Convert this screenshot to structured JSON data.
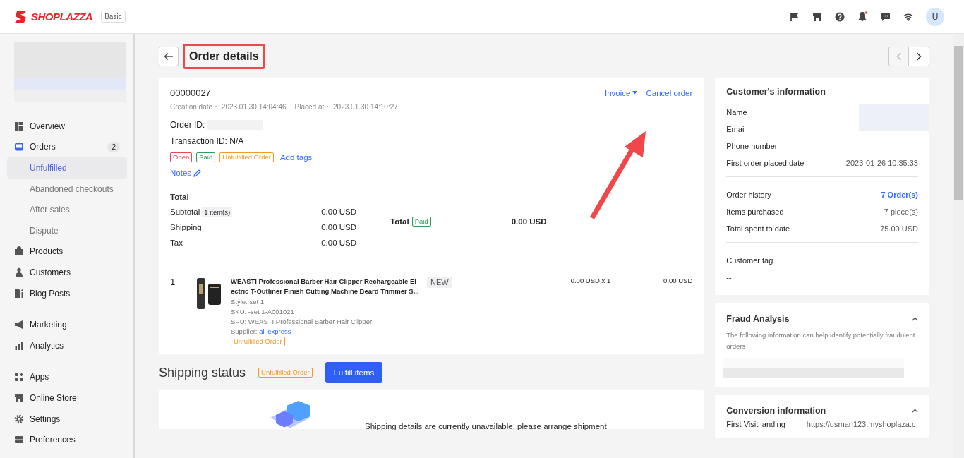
{
  "topbar": {
    "logo": "SHOPLAZZA",
    "plan": "Basic",
    "notification_dot": true,
    "avatar": "U"
  },
  "sidebar": {
    "groups": [
      [
        {
          "label": "Overview",
          "kind": "main",
          "selected": false
        },
        {
          "label": "Orders",
          "kind": "main",
          "selected": false,
          "badge": "2"
        },
        {
          "label": "Unfulfilled",
          "kind": "sub",
          "selected": true
        },
        {
          "label": "Abandoned checkouts",
          "kind": "sub",
          "selected": false
        },
        {
          "label": "After sales",
          "kind": "sub",
          "selected": false
        },
        {
          "label": "Dispute",
          "kind": "sub",
          "selected": false
        },
        {
          "label": "Products",
          "kind": "main",
          "selected": false
        },
        {
          "label": "Customers",
          "kind": "main",
          "selected": false
        },
        {
          "label": "Blog Posts",
          "kind": "main",
          "selected": false
        }
      ],
      [
        {
          "label": "Marketing",
          "kind": "main",
          "selected": false
        },
        {
          "label": "Analytics",
          "kind": "main",
          "selected": false
        }
      ],
      [
        {
          "label": "Apps",
          "kind": "main",
          "selected": false
        },
        {
          "label": "Online Store",
          "kind": "main",
          "selected": false
        },
        {
          "label": "Settings",
          "kind": "main",
          "selected": false
        },
        {
          "label": "Preferences",
          "kind": "main",
          "selected": false
        }
      ]
    ]
  },
  "page": {
    "title": "Order details",
    "prev_disabled": true,
    "next_disabled": false
  },
  "order": {
    "number": "00000027",
    "invoice": "Invoice",
    "cancel": "Cancel order",
    "meta": [
      {
        "label": "Creation date：",
        "value": "2023.01.30 14:04:46"
      },
      {
        "label": "Placed at：",
        "value": "2023.01.30 14:10:27"
      }
    ],
    "order_id": "Order ID:",
    "transaction": "Transaction ID: N/A",
    "tags": [
      {
        "label": "Open",
        "color": "#e5484d"
      },
      {
        "label": "Paid",
        "color": "#2e9e5b"
      },
      {
        "label": "Unfulfilled Order",
        "color": "#f59a23"
      }
    ],
    "add_tags": "Add tags",
    "notes": "Notes",
    "totals": {
      "heading": "Total",
      "rows": [
        {
          "label": "Subtotal",
          "badge": "1 item(s)",
          "value": "0.00 USD"
        },
        {
          "label": "Shipping",
          "value": "0.00 USD"
        },
        {
          "label": "Tax",
          "value": "0.00 USD"
        }
      ],
      "grand_label": "Total",
      "grand_tag": {
        "label": "Paid",
        "color": "#2e9e5b"
      },
      "grand_value": "0.00 USD"
    },
    "items": [
      {
        "index": "1",
        "title": "WEASTI Professional Barber Hair Clipper Rechargeable Electric T-Outliner Finish Cutting Machine Beard Trimmer S...",
        "badge": "NEW",
        "style": "Style: set 1",
        "sku": "SKU: -set 1-A001021",
        "spu": "SPU: WEASTI Professional Barber Hair Clipper",
        "supplier_label": "Supplier:",
        "supplier": "ali express",
        "tag": {
          "label": "Unfulfilled Order",
          "color": "#f59a23"
        },
        "unit": "0.00 USD x 1",
        "total": "0.00 USD"
      }
    ]
  },
  "shipping": {
    "title": "Shipping status",
    "tag": {
      "label": "Unfulfilled Order",
      "color": "#f59a23"
    },
    "button": "Fulfill items",
    "message": "Shipping details are currently unavailable, please arrange shipment"
  },
  "customer": {
    "title": "Customer's information",
    "fields": [
      {
        "label": "Name"
      },
      {
        "label": "Email"
      },
      {
        "label": "Phone number"
      },
      {
        "label": "First order placed date",
        "value": "2023-01-26 10:35:33"
      }
    ],
    "stats": [
      {
        "label": "Order history",
        "value": "7 Order(s)",
        "link": true
      },
      {
        "label": "Items purchased",
        "value": "7 piece(s)",
        "link": false
      },
      {
        "label": "Total spent to date",
        "value": "75.00 USD",
        "link": false
      }
    ],
    "tag_label": "Customer tag",
    "tag_value": "--"
  },
  "fraud": {
    "title": "Fraud Analysis",
    "expanded": true,
    "text": "The following information can help identify potentially fraudulent orders"
  },
  "conversion": {
    "title": "Conversion information",
    "expanded": true,
    "rows": [
      {
        "label": "First Visit landing",
        "value": "https://usman123.myshoplaza.c"
      }
    ]
  }
}
